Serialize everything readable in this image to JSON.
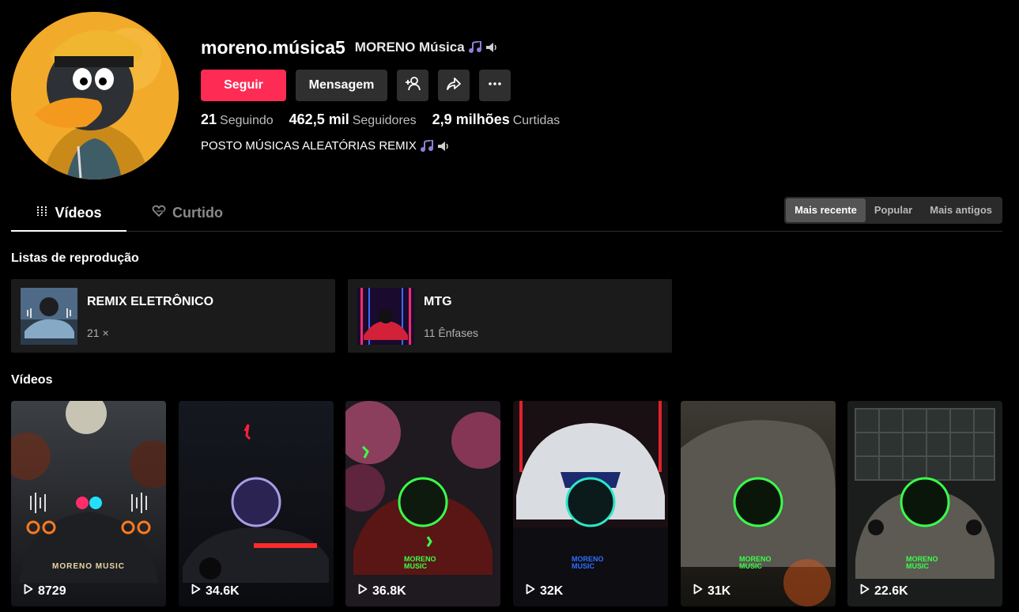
{
  "profile": {
    "username": "moreno.música5",
    "nickname": "MORENO Música",
    "bio": "POSTO MÚSICAS ALEATÓRIAS REMIX"
  },
  "actions": {
    "follow_label": "Seguir",
    "message_label": "Mensagem"
  },
  "stats": {
    "following_value": "21",
    "following_label": "Seguindo",
    "followers_value": "462,5 mil",
    "followers_label": "Seguidores",
    "likes_value": "2,9 milhões",
    "likes_label": "Curtidas"
  },
  "tabs": [
    {
      "label": "Vídeos"
    },
    {
      "label": "Curtido"
    }
  ],
  "sort": [
    {
      "label": "Mais recente"
    },
    {
      "label": "Popular"
    },
    {
      "label": "Mais antigos"
    }
  ],
  "playlists_title": "Listas de reprodução",
  "playlists": [
    {
      "name": "REMIX ELETRÔNICO",
      "count": "21 ×"
    },
    {
      "name": "MTG",
      "count": "11 Ênfases"
    }
  ],
  "videos_title": "Vídeos",
  "videos": [
    {
      "views": "8729",
      "watermark": "MORENO MUSIC"
    },
    {
      "views": "34.6K",
      "watermark": ""
    },
    {
      "views": "36.8K",
      "watermark": "MORENO MUSIC"
    },
    {
      "views": "32K",
      "watermark": "MORENO MUSIC"
    },
    {
      "views": "31K",
      "watermark": "MORENO MUSIC"
    },
    {
      "views": "22.6K",
      "watermark": "MORENO MUSIC"
    }
  ],
  "colors": {
    "accent": "#fe2c55",
    "button_bg": "#2f2f2f",
    "card_bg": "#1b1b1b"
  }
}
